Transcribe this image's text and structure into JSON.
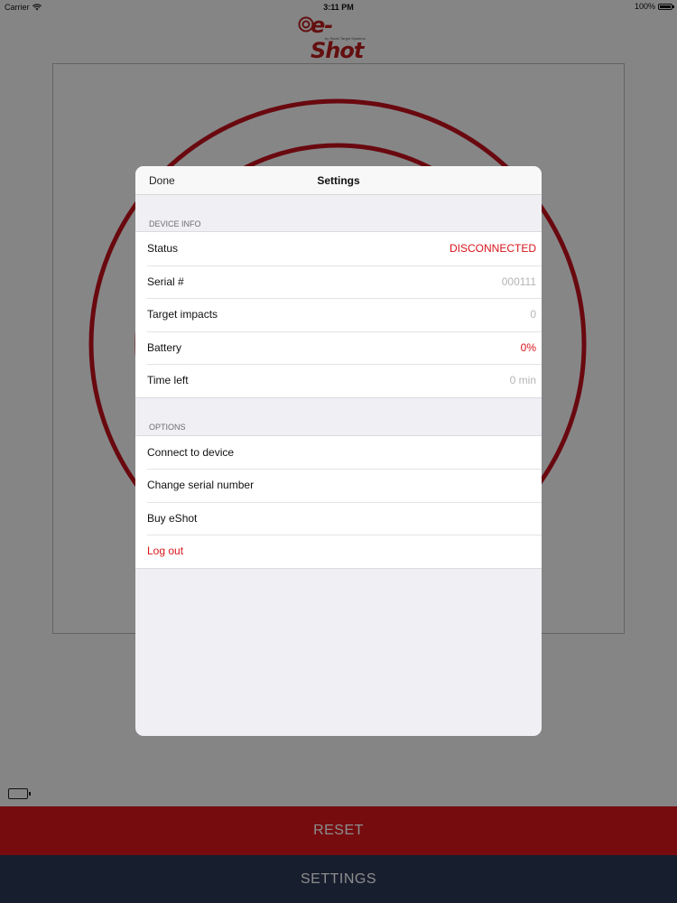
{
  "status_bar": {
    "carrier": "Carrier",
    "time": "3:11 PM",
    "battery": "100%"
  },
  "logo": {
    "text": "e-Shot",
    "tagline": "by Smart Target Systems"
  },
  "bottom_bar": {
    "reset_label": "RESET",
    "settings_label": "SETTINGS"
  },
  "settings": {
    "title": "Settings",
    "done_label": "Done",
    "device_info": {
      "header": "DEVICE INFO",
      "rows": [
        {
          "label": "Status",
          "value": "DISCONNECTED"
        },
        {
          "label": "Serial #",
          "value": "000111"
        },
        {
          "label": "Target impacts",
          "value": "0"
        },
        {
          "label": "Battery",
          "value": "0%"
        },
        {
          "label": "Time left",
          "value": "0 min"
        }
      ]
    },
    "options": {
      "header": "OPTIONS",
      "items": [
        {
          "label": "Connect to device"
        },
        {
          "label": "Change serial number"
        },
        {
          "label": "Buy eShot"
        },
        {
          "label": "Log out"
        }
      ]
    }
  },
  "colors": {
    "accent_red": "#d8141a",
    "reset_bg": "#d9161c",
    "settings_bg": "#2a3854",
    "target_ring": "#c0111c"
  }
}
